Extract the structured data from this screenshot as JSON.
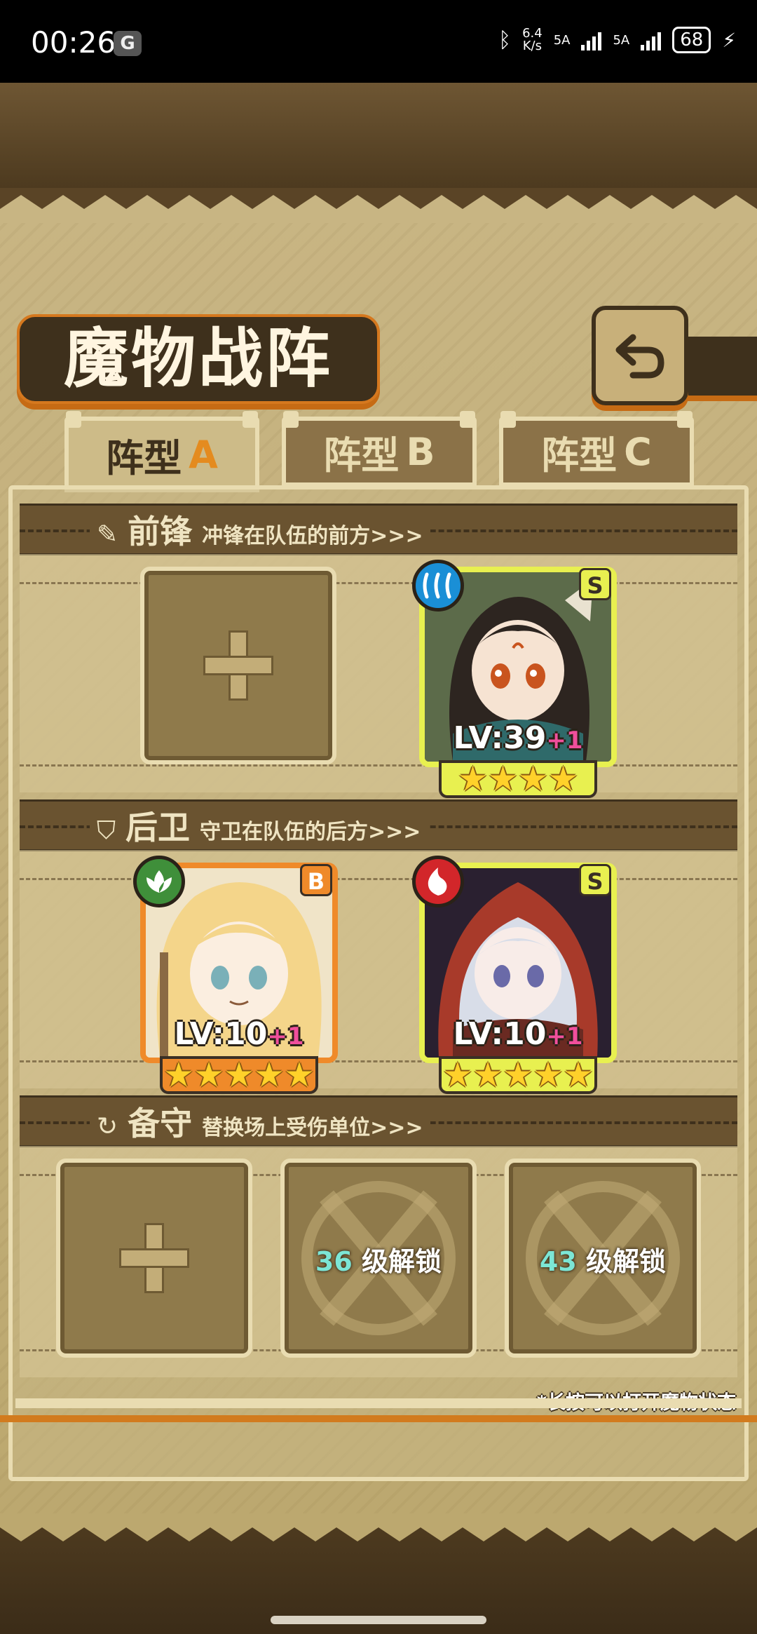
{
  "status_bar": {
    "time": "00:26",
    "net_speed_value": "6.4",
    "net_speed_unit": "K/s",
    "sim1_label": "5A",
    "sim2_label": "5A",
    "battery": "68"
  },
  "header": {
    "title": "魔物战阵",
    "back_icon": "return-arrow-icon"
  },
  "tabs": [
    {
      "prefix": "阵型",
      "letter": "A",
      "active": true
    },
    {
      "prefix": "阵型",
      "letter": "B",
      "active": false
    },
    {
      "prefix": "阵型",
      "letter": "C",
      "active": false
    }
  ],
  "sections": {
    "vanguard": {
      "name": "前锋",
      "desc": "冲锋在队伍的前方>>>",
      "icon": "sword-icon"
    },
    "rearguard": {
      "name": "后卫",
      "desc": "守卫在队伍的后方>>>",
      "icon": "shield-icon"
    },
    "reserve": {
      "name": "备守",
      "desc": "替换场上受伤单位>>>",
      "icon": "swap-icon"
    }
  },
  "cards": {
    "vanguard_right": {
      "rank": "S",
      "element": "water-icon",
      "lv_label": "LV:",
      "level": "39",
      "bonus": "+1",
      "stars": 4
    },
    "rear_left": {
      "rank": "B",
      "element": "leaf-icon",
      "lv_label": "LV:",
      "level": "10",
      "bonus": "+1",
      "stars": 5
    },
    "rear_right": {
      "rank": "S",
      "element": "fire-icon",
      "lv_label": "LV:",
      "level": "10",
      "bonus": "+1",
      "stars": 5
    }
  },
  "reserve_slots": [
    {
      "type": "empty"
    },
    {
      "type": "locked",
      "level": "36",
      "text": "级解锁"
    },
    {
      "type": "locked",
      "level": "43",
      "text": "级解锁"
    }
  ],
  "hint": "*长按可以打开魔物状态",
  "colors": {
    "accent_orange": "#d5781e",
    "rank_s": "#e8f050",
    "rank_b": "#ef8a2a",
    "unlock_level": "#7ce6d6"
  }
}
